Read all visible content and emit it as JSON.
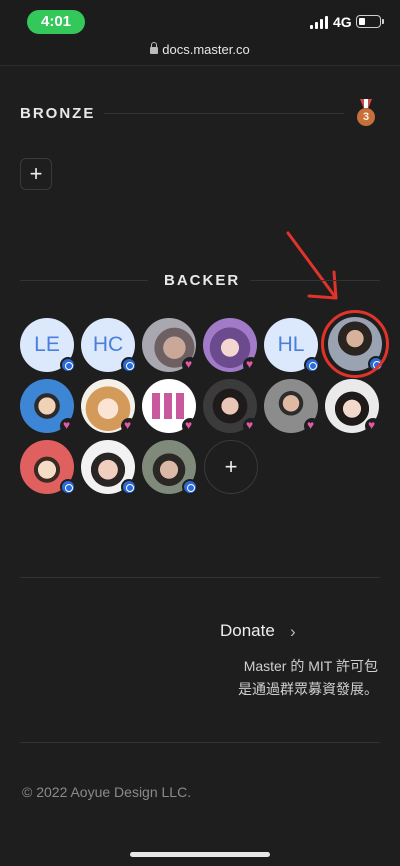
{
  "status": {
    "time": "4:01",
    "network": "4G",
    "url": "docs.master.co"
  },
  "bronze": {
    "title": "BRONZE",
    "medal_number": "3",
    "add_label": "+"
  },
  "backer": {
    "title": "BACKER",
    "add_label": "+",
    "avatars": [
      {
        "initials": "LE",
        "badge": "blue"
      },
      {
        "initials": "HC",
        "badge": "blue"
      },
      {
        "initials": "",
        "badge": "pink"
      },
      {
        "initials": "",
        "badge": "pink"
      },
      {
        "initials": "HL",
        "badge": "blue"
      },
      {
        "initials": "",
        "badge": "blue",
        "highlighted": true
      },
      {
        "initials": "",
        "badge": "pink"
      },
      {
        "initials": "",
        "badge": "pink"
      },
      {
        "initials": "",
        "badge": "pink"
      },
      {
        "initials": "",
        "badge": "pink"
      },
      {
        "initials": "",
        "badge": "pink"
      },
      {
        "initials": "",
        "badge": "pink"
      },
      {
        "initials": "",
        "badge": "blue"
      },
      {
        "initials": "",
        "badge": "blue"
      },
      {
        "initials": "",
        "badge": "blue"
      }
    ]
  },
  "footer": {
    "donate_label": "Donate",
    "license_line1": "Master 的 MIT 許可包",
    "license_line2": "是通過群眾募資發展。",
    "copyright": "© 2022 Aoyue Design LLC."
  },
  "colors": {
    "background": "#1e1e1e",
    "time_pill": "#34c759",
    "highlight": "#e0342a",
    "badge_blue": "#2b6bd8",
    "badge_pink": "#e05aa8"
  }
}
